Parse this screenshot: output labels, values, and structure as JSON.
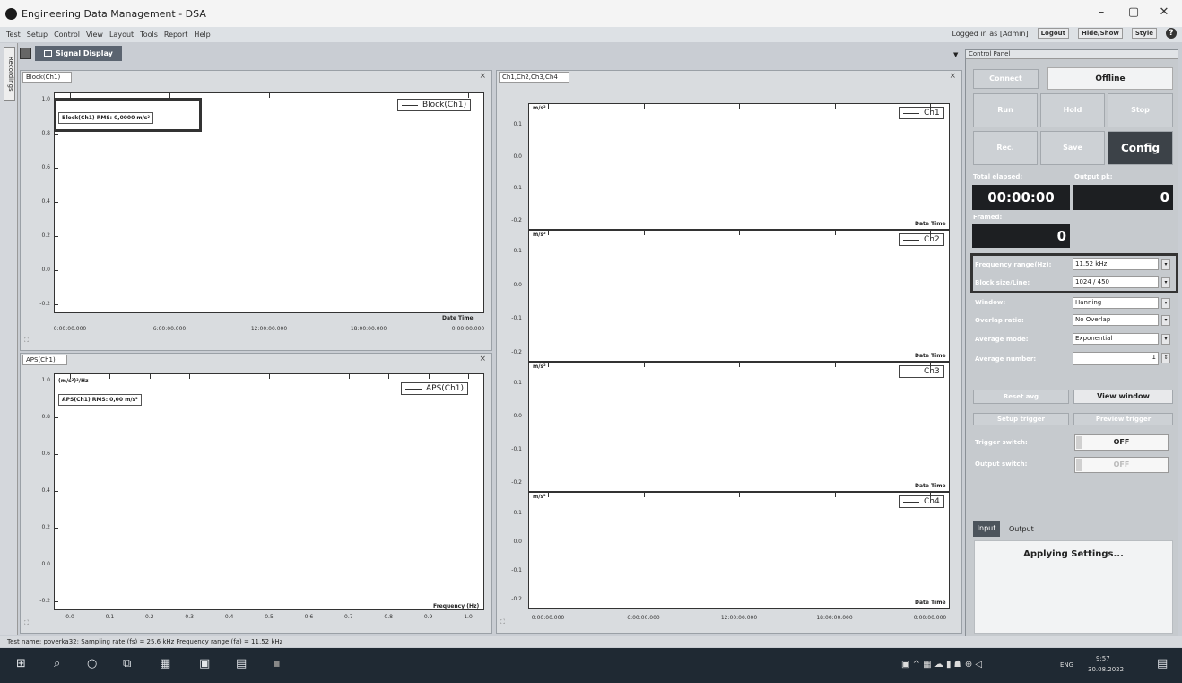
{
  "window": {
    "title": "Engineering Data Management - DSA",
    "minimize": "–",
    "maximize": "▢",
    "close": "✕"
  },
  "menu": [
    "Test",
    "Setup",
    "Control",
    "View",
    "Layout",
    "Tools",
    "Report",
    "Help"
  ],
  "menu_right": {
    "logged": "Logged in as [Admin]",
    "logout": "Logout",
    "hideshow": "Hide/Show",
    "style": "Style",
    "help": "?"
  },
  "side_tab": "Recordings",
  "doc_tab": "Signal Display",
  "block": {
    "tab": "Block(Ch1)",
    "legend": "Block(Ch1)",
    "rms": "Block(Ch1) RMS: 0,0000 m/s²",
    "yticks": [
      "1.0",
      "0.8",
      "0.6",
      "0.4",
      "0.2",
      "0.0",
      "-0.2"
    ],
    "xticks": [
      "0:00:00.000",
      "6:00:00.000",
      "12:00:00.000",
      "18:00:00.000",
      "0:00:00.000"
    ],
    "axis": "Date Time"
  },
  "aps": {
    "tab": "APS(Ch1)",
    "legend": "APS(Ch1)",
    "unit": "(m/s²)²/Hz",
    "rms": "APS(Ch1) RMS: 0,00 m/s²",
    "yticks": [
      "1.0",
      "0.8",
      "0.6",
      "0.4",
      "0.2",
      "0.0",
      "-0.2"
    ],
    "xticks": [
      "0.0",
      "0.1",
      "0.2",
      "0.3",
      "0.4",
      "0.5",
      "0.6",
      "0.7",
      "0.8",
      "0.9",
      "1.0"
    ],
    "axis": "Frequency (Hz)"
  },
  "multi": {
    "tab": "Ch1,Ch2,Ch3,Ch4",
    "unit": "m/s²",
    "axis": "Date Time",
    "yticks": [
      "0.1",
      "0.0",
      "-0.1",
      "-0.2"
    ],
    "channels": [
      "Ch1",
      "Ch2",
      "Ch3",
      "Ch4"
    ],
    "xticks": [
      "0:00:00.000",
      "6:00:00.000",
      "12:00:00.000",
      "18:00:00.000",
      "0:00:00.000"
    ]
  },
  "cp": {
    "title": "Control Panel",
    "connect": "Connect",
    "offline": "Offline",
    "run": "Run",
    "hold": "Hold",
    "stop": "Stop",
    "rec": "Rec.",
    "save": "Save",
    "config": "Config",
    "total_elapsed": "Total elapsed:",
    "elapsed_val": "00:00:00",
    "output_pk": "Output pk:",
    "output_val": "0",
    "framed": "Framed:",
    "framed_val": "0",
    "freq_label": "Frequency range(Hz):",
    "freq_val": "11.52 kHz",
    "block_label": "Block size/Line:",
    "block_val": "1024 / 450",
    "window_label": "Window:",
    "window_val": "Hanning",
    "overlap_label": "Overlap ratio:",
    "overlap_val": "No Overlap",
    "avgmode_label": "Average mode:",
    "avgmode_val": "Exponential",
    "avgnum_label": "Average number:",
    "avgnum_val": "1",
    "reset": "Reset avg",
    "view": "View window",
    "setup_trigger": "Setup trigger",
    "preview_trigger": "Preview trigger",
    "trigger_label": "Trigger switch:",
    "trigger_val": "OFF",
    "output_label": "Output switch:",
    "output_val2": "OFF",
    "tab_input": "Input",
    "tab_output": "Output",
    "applying": "Applying Settings..."
  },
  "status": "Test name: poverka32; Sampling rate (fs) = 25,6 kHz Frequency range (fa) = 11,52 kHz",
  "tray": {
    "lang": "ENG",
    "time": "9:57",
    "date": "30.08.2022"
  }
}
